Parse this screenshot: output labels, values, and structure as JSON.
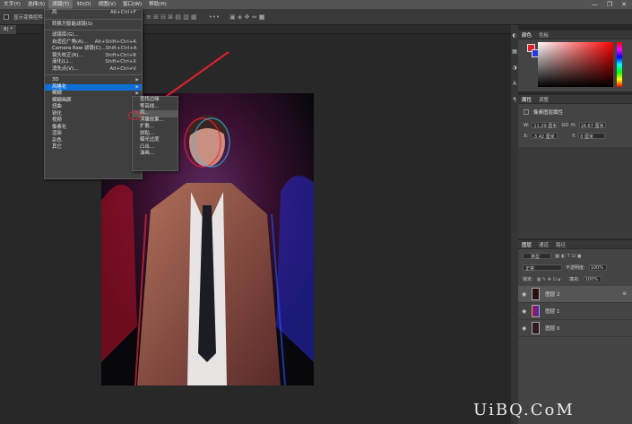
{
  "menubar": {
    "items": [
      "文字(Y)",
      "选择(S)",
      "滤镜(T)",
      "3D(D)",
      "视图(V)",
      "窗口(W)",
      "帮助(H)"
    ],
    "window_controls": [
      "—",
      "❐",
      "✕"
    ]
  },
  "options_bar": {
    "checkbox_label": "显示变换控件"
  },
  "doc_tab": {
    "label": "8) *"
  },
  "filter_menu": {
    "items": [
      {
        "label": "风",
        "shortcut": "Alt+Ctrl+F"
      },
      {
        "sep": true
      },
      {
        "label": "转换为智能滤镜(S)",
        "shortcut": ""
      },
      {
        "sep": true
      },
      {
        "label": "滤镜库(G)...",
        "shortcut": ""
      },
      {
        "label": "自适应广角(A)...",
        "shortcut": "Alt+Shift+Ctrl+A"
      },
      {
        "label": "Camera Raw 滤镜(C)...",
        "shortcut": "Shift+Ctrl+A"
      },
      {
        "label": "镜头校正(R)...",
        "shortcut": "Shift+Ctrl+R"
      },
      {
        "label": "液化(L)...",
        "shortcut": "Shift+Ctrl+X"
      },
      {
        "label": "消失点(V)...",
        "shortcut": "Alt+Ctrl+V"
      },
      {
        "sep": true
      },
      {
        "label": "3D",
        "arrow": true
      },
      {
        "label": "风格化",
        "arrow": true,
        "highlight": true
      },
      {
        "label": "模糊",
        "arrow": true
      },
      {
        "label": "模糊画廊",
        "arrow": true
      },
      {
        "label": "扭曲",
        "arrow": true
      },
      {
        "label": "锐化",
        "arrow": true
      },
      {
        "label": "视频",
        "arrow": true
      },
      {
        "label": "像素化",
        "arrow": true
      },
      {
        "label": "渲染",
        "arrow": true
      },
      {
        "label": "杂色",
        "arrow": true
      },
      {
        "label": "其它",
        "arrow": true
      }
    ]
  },
  "stylize_submenu": {
    "items": [
      {
        "label": "查找边缘"
      },
      {
        "label": "等高线..."
      },
      {
        "label": "风...",
        "highlight": true
      },
      {
        "label": "浮雕效果..."
      },
      {
        "label": "扩散..."
      },
      {
        "label": "拼贴..."
      },
      {
        "label": "曝光过度"
      },
      {
        "label": "凸出..."
      },
      {
        "label": "油画..."
      }
    ]
  },
  "color_panel": {
    "tabs": [
      "颜色",
      "色板"
    ],
    "fg_color": "#e0202a",
    "bg_color": "#2a38d8"
  },
  "properties_panel": {
    "tabs": [
      "属性",
      "调整"
    ],
    "title": "像素图层属性",
    "w_label": "W:",
    "w_value": "11.29 厘米",
    "link": "GO",
    "h_label": "H:",
    "h_value": "16.67 厘米",
    "x_label": "X:",
    "x_value": "-3.42 厘米",
    "y_label": "Y:",
    "y_value": "0 厘米"
  },
  "layers_panel": {
    "tabs": [
      "图层",
      "通道",
      "路径"
    ],
    "filter_label": "类型",
    "blend_mode": "正常",
    "opacity_label": "不透明度:",
    "opacity_value": "100%",
    "lock_label": "锁定:",
    "fill_label": "填充:",
    "fill_value": "100%",
    "layers": [
      {
        "name": "图层 2",
        "selected": true
      },
      {
        "name": "图层 1",
        "selected": false
      },
      {
        "name": "图层 0",
        "selected": false
      }
    ]
  },
  "watermark": {
    "text": "UiBQ.CoM"
  }
}
